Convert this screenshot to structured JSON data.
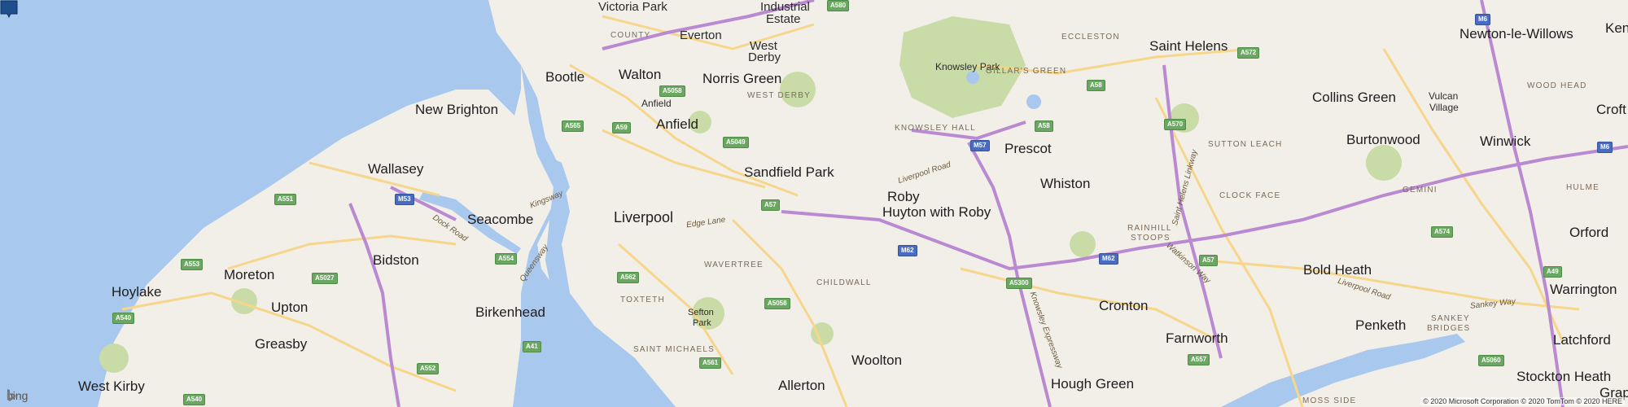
{
  "map": {
    "provider": "bing",
    "copyright": "© 2020 Microsoft Corporation © 2020 TomTom © 2020 HERE",
    "colors": {
      "water": "#a9c8ee",
      "land": "#f2efe9",
      "park": "#c9dca8",
      "motorway": "#b98ad2",
      "aroad": "#f6d68a",
      "marker": "#1f4e8c"
    }
  },
  "towns": {
    "victoria_park": "Victoria Park",
    "industrial": "Industrial",
    "estate": "Estate",
    "county": "COUNTY",
    "everton": "Everton",
    "west": "West",
    "derby": "Derby",
    "bootle": "Bootle",
    "walton": "Walton",
    "norris_green": "Norris Green",
    "anfield_small": "Anfield",
    "anfield": "Anfield",
    "west_derby": "WEST DERBY",
    "new_brighton": "New Brighton",
    "wallasey": "Wallasey",
    "seacombe": "Seacombe",
    "liverpool": "Liverpool",
    "sandfield_park": "Sandfield Park",
    "bidston": "Bidston",
    "hoylake": "Hoylake",
    "moreton": "Moreton",
    "upton": "Upton",
    "birkenhead": "Birkenhead",
    "greasby": "Greasby",
    "west_kirby": "West Kirby",
    "wavertree": "WAVERTREE",
    "toxteth": "TOXTETH",
    "sefton": "Sefton",
    "park": "Park",
    "saint_michaels": "SAINT MICHAELS",
    "childwall": "CHILDWALL",
    "woolton": "Woolton",
    "allerton": "Allerton",
    "knowsley_park": "Knowsley Park",
    "knowsley_hall": "KNOWSLEY HALL",
    "gillars_green": "GILLAR'S GREEN",
    "eccleston": "ECCLESTON",
    "saint_helens": "Saint Helens",
    "prescot": "Prescot",
    "roby": "Roby",
    "huyton": "Huyton with Roby",
    "whiston": "Whiston",
    "rainhill": "RAINHILL",
    "stoops": "STOOPS",
    "sutton_leach": "SUTTON LEACH",
    "clock_face": "CLOCK FACE",
    "cronton": "Cronton",
    "farnworth": "Farnworth",
    "hough_green": "Hough Green",
    "bold_heath": "Bold Heath",
    "newton": "Newton-le-Willows",
    "kenyon": "Kenyor",
    "collins_green": "Collins Green",
    "vulcan": "Vulcan",
    "village": "Village",
    "wood_head": "WOOD HEAD",
    "croft": "Croft",
    "burtonwood": "Burtonwood",
    "winwick": "Winwick",
    "gemini": "GEMINI",
    "hulme": "HULME",
    "orford": "Orford",
    "warrington": "Warrington",
    "penketh": "Penketh",
    "sankey": "SANKEY",
    "bridges": "BRIDGES",
    "latchford": "Latchford",
    "stockton_heath": "Stockton Heath",
    "moss_side": "MOSS SIDE",
    "grap": "Grap"
  },
  "roads": {
    "kingsway": "Kingsway",
    "dock_road": "Dock Road",
    "queensway": "Queensway",
    "edge_lane": "Edge Lane",
    "liverpool_road": "Liverpool Road",
    "liverpool_road_2": "Liverpool Road",
    "saint_helens_linkway": "Saint Helens Linkway",
    "watkinson_way": "Watkinson Way",
    "knowsley_expressway": "Knowsley Expressway",
    "sankey_way": "Sankey Way"
  },
  "shields": {
    "a580": "A580",
    "a5058": "A5058",
    "a565": "A565",
    "a59": "A59",
    "a5049": "A5049",
    "a57": "A57",
    "a551": "A551",
    "m53": "M53",
    "a553": "A553",
    "a554": "A554",
    "a5027": "A5027",
    "a540": "A540",
    "a540b": "A540",
    "a41": "A41",
    "a552": "A552",
    "a562": "A562",
    "a561": "A561",
    "a5058b": "A5058",
    "m62": "M62",
    "m57": "M57",
    "a58": "A58",
    "a58b": "A58",
    "a572": "A572",
    "a570": "A570",
    "a57b": "A57",
    "a5300": "A5300",
    "m62b": "M62",
    "a557": "A557",
    "m6": "M6",
    "m6b": "M6",
    "a574": "A574",
    "a49": "A49",
    "a5060": "A5060"
  }
}
